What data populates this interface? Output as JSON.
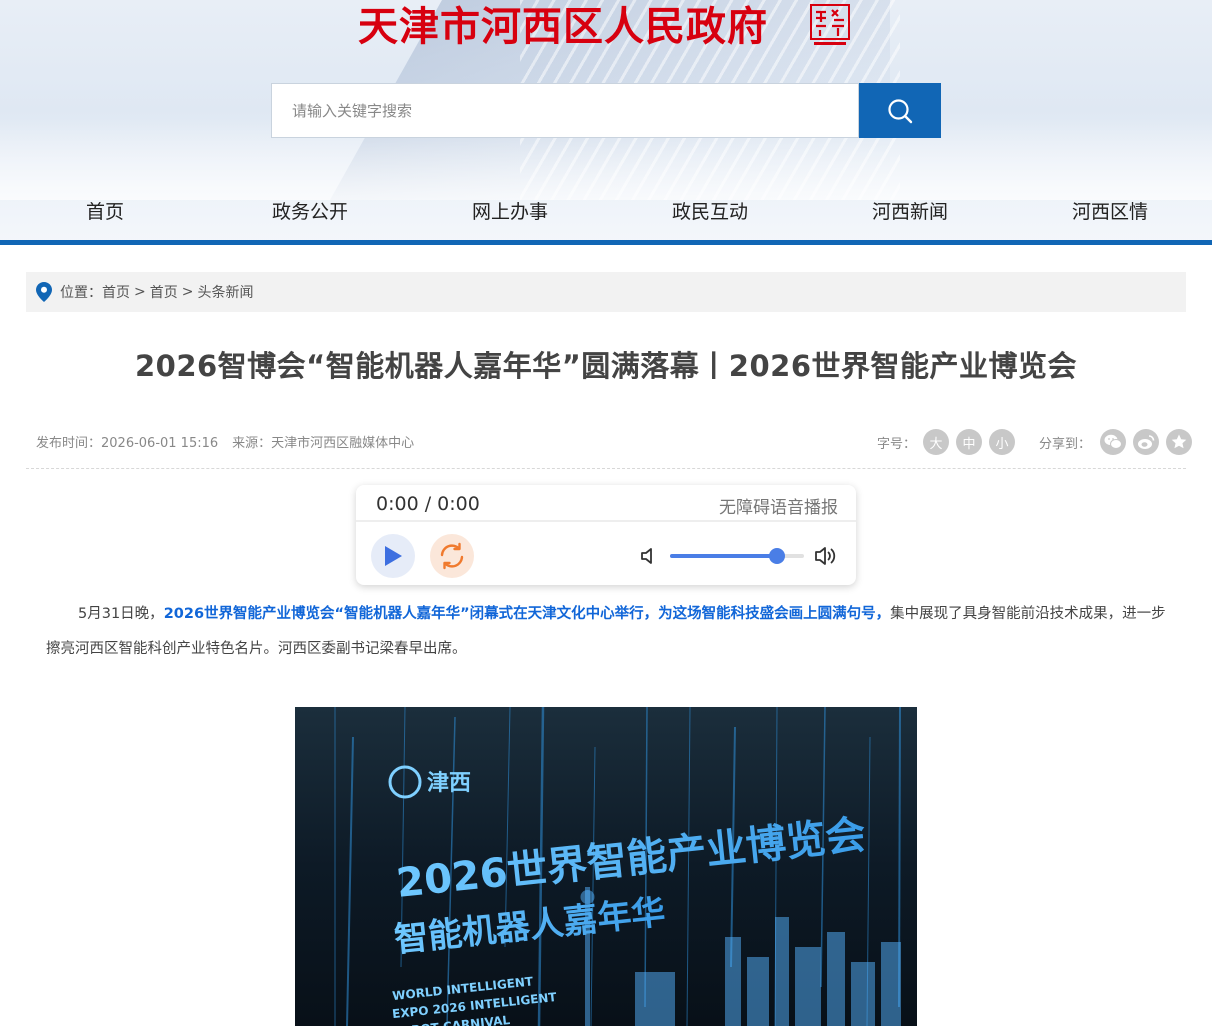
{
  "header": {
    "site_title": "天津市河西区人民政府",
    "search": {
      "placeholder": "请输入关键字搜索"
    },
    "nav": [
      {
        "label": "首页"
      },
      {
        "label": "政务公开"
      },
      {
        "label": "网上办事"
      },
      {
        "label": "政民互动"
      },
      {
        "label": "河西新闻"
      },
      {
        "label": "河西区情"
      }
    ]
  },
  "breadcrumb": {
    "prefix": "位置：",
    "items": [
      "首页",
      "首页",
      "头条新闻"
    ],
    "separator": ">"
  },
  "article": {
    "title": "2026智博会“智能机器人嘉年华”圆满落幕丨2026世界智能产业博览会",
    "publish_time": "发布时间：2026-06-01 15:16",
    "source": "来源：天津市河西区融媒体中心",
    "font_size_label": "字号：",
    "font_sizes": [
      "大",
      "中",
      "小"
    ],
    "share_label": "分享到：",
    "paragraph": {
      "lead": "5月31日晚，",
      "highlight": "2026世界智能产业博览会“智能机器人嘉年华”闭幕式在天津文化中心举行，为这场智能科技盛会画上圆满句号，",
      "rest": "集中展现了具身智能前沿技术成果，进一步擦亮河西区智能科创产业特色名片。河西区委副书记梁春早出席。"
    },
    "photo": {
      "logo_text": "津西",
      "line1": "2026世界智能产业博览会",
      "line2": "智能机器人嘉年华",
      "en1": "WORLD INTELLIGENT",
      "en2": "EXPO 2026 INTELLIGENT",
      "en3": "ROBOT CARNIVAL"
    }
  },
  "player": {
    "time": "0:00 / 0:00",
    "label": "无障碍语音播报",
    "volume": 0.8
  },
  "colors": {
    "brand_red": "#d7000f",
    "brand_blue": "#1166b5",
    "highlight_blue": "#1166d8"
  },
  "icons": {
    "search": "search-icon",
    "location": "location-pin-icon",
    "play": "play-icon",
    "loop": "loop-icon",
    "volume_mute": "volume-mute-icon",
    "volume_max": "volume-max-icon",
    "wechat": "wechat-icon",
    "weibo": "weibo-icon",
    "qzone": "qzone-star-icon"
  }
}
